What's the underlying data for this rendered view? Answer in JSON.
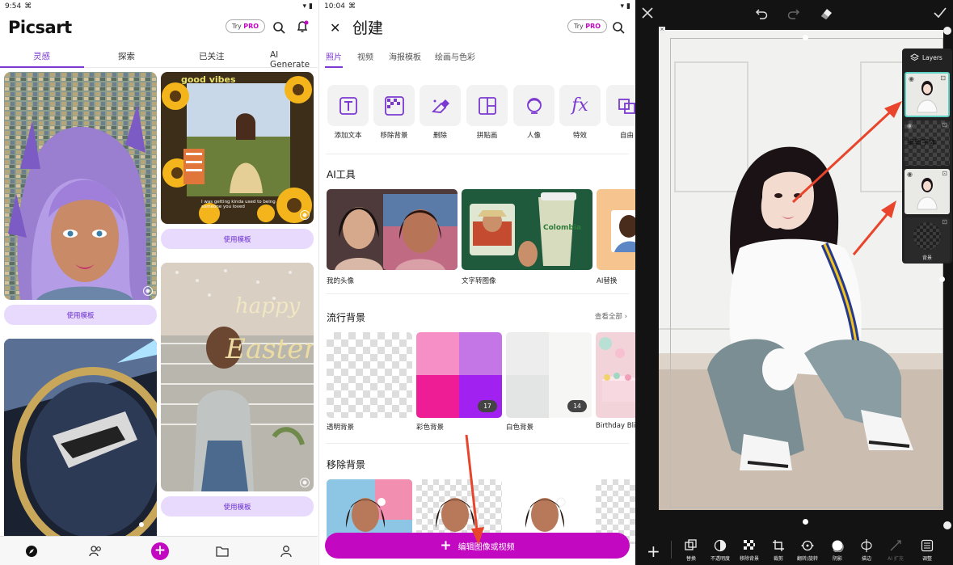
{
  "panel1": {
    "status": {
      "time": "9:54"
    },
    "logo": "Picsart",
    "try_pro": {
      "try": "Try",
      "pro": "PRO"
    },
    "tabs": [
      {
        "label": "灵感"
      },
      {
        "label": "探索"
      },
      {
        "label": "已关注"
      },
      {
        "label": "AI Generate"
      }
    ],
    "cards": [
      {
        "label": "使用模板"
      },
      {
        "label": "使用模板"
      },
      {
        "label": "使用模板"
      }
    ],
    "card_text": {
      "good_vibes": "good vibes",
      "caption": "I was getting kinda used to being someone you loved",
      "happy": "happy",
      "easter": "Easter"
    },
    "accent": "#c209c1",
    "tab_accent": "#7b39d1"
  },
  "panel2": {
    "status": {
      "time": "10:04"
    },
    "title": "创建",
    "try_pro": {
      "try": "Try",
      "pro": "PRO"
    },
    "tabs": [
      {
        "label": "照片"
      },
      {
        "label": "视频"
      },
      {
        "label": "海报模板"
      },
      {
        "label": "绘画与色彩"
      }
    ],
    "tools": [
      {
        "label": "添加文本",
        "icon": "text-icon"
      },
      {
        "label": "移除背景",
        "icon": "remove-bg-icon"
      },
      {
        "label": "删除",
        "icon": "eraser-icon"
      },
      {
        "label": "拼贴画",
        "icon": "collage-icon"
      },
      {
        "label": "人像",
        "icon": "portrait-icon"
      },
      {
        "label": "特效",
        "icon": "fx-icon"
      },
      {
        "label": "自由",
        "icon": "free-crop-icon"
      }
    ],
    "ai_section": {
      "title": "AI工具",
      "items": [
        {
          "label": "我的头像"
        },
        {
          "label": "文字转图像"
        },
        {
          "label": "AI替换"
        }
      ],
      "can_text": "Colombia"
    },
    "bg_section": {
      "title": "流行背景",
      "see_all": "查看全部",
      "items": [
        {
          "label": "透明背景",
          "count": ""
        },
        {
          "label": "彩色背景",
          "count": "17"
        },
        {
          "label": "白色背景",
          "count": "14"
        },
        {
          "label": "Birthday Bli",
          "count": ""
        }
      ]
    },
    "removebg_section": {
      "title": "移除背景"
    },
    "edit_button": "编辑图像或视频"
  },
  "panel3": {
    "layers": {
      "title": "Layers",
      "items": [
        {
          "label": ""
        },
        {
          "label": "编辑字体"
        },
        {
          "label": ""
        },
        {
          "label": "背景"
        }
      ]
    },
    "toolbar": [
      {
        "label": "替换",
        "icon": "replace-icon"
      },
      {
        "label": "不透明度",
        "icon": "opacity-icon"
      },
      {
        "label": "移除背景",
        "icon": "remove-bg-icon"
      },
      {
        "label": "裁剪",
        "icon": "crop-icon"
      },
      {
        "label": "翻转/旋转",
        "icon": "flip-rotate-icon"
      },
      {
        "label": "阴影",
        "icon": "shadow-icon"
      },
      {
        "label": "描边",
        "icon": "outline-icon"
      },
      {
        "label": "AI 扩充",
        "icon": "ai-expand-icon"
      },
      {
        "label": "调整",
        "icon": "adjust-icon"
      }
    ],
    "selection_color": "#5fd0c4",
    "arrow_color": "#e8452c"
  }
}
